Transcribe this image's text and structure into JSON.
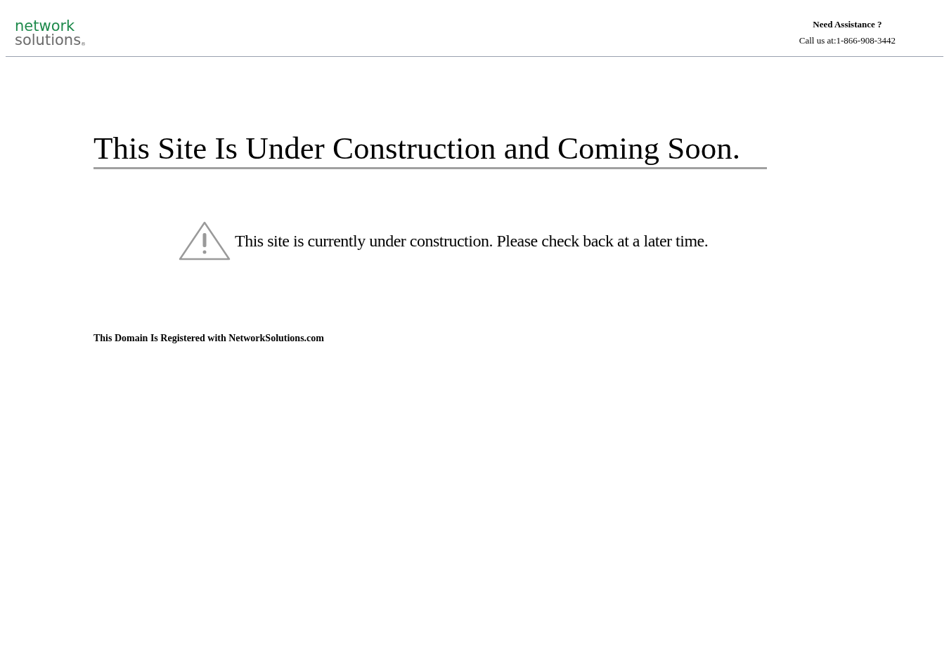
{
  "logo": {
    "line_1": "network",
    "line_2": "solutions",
    "mark": "®"
  },
  "assistance": {
    "title": "Need Assistance ?",
    "phone": "Call us at:1-866-908-3442"
  },
  "heading": "This Site Is Under Construction and Coming Soon.",
  "notice": "This site is currently under construction. Please check back at a later time.",
  "footer_note": "This Domain Is Registered with NetworkSolutions.com"
}
